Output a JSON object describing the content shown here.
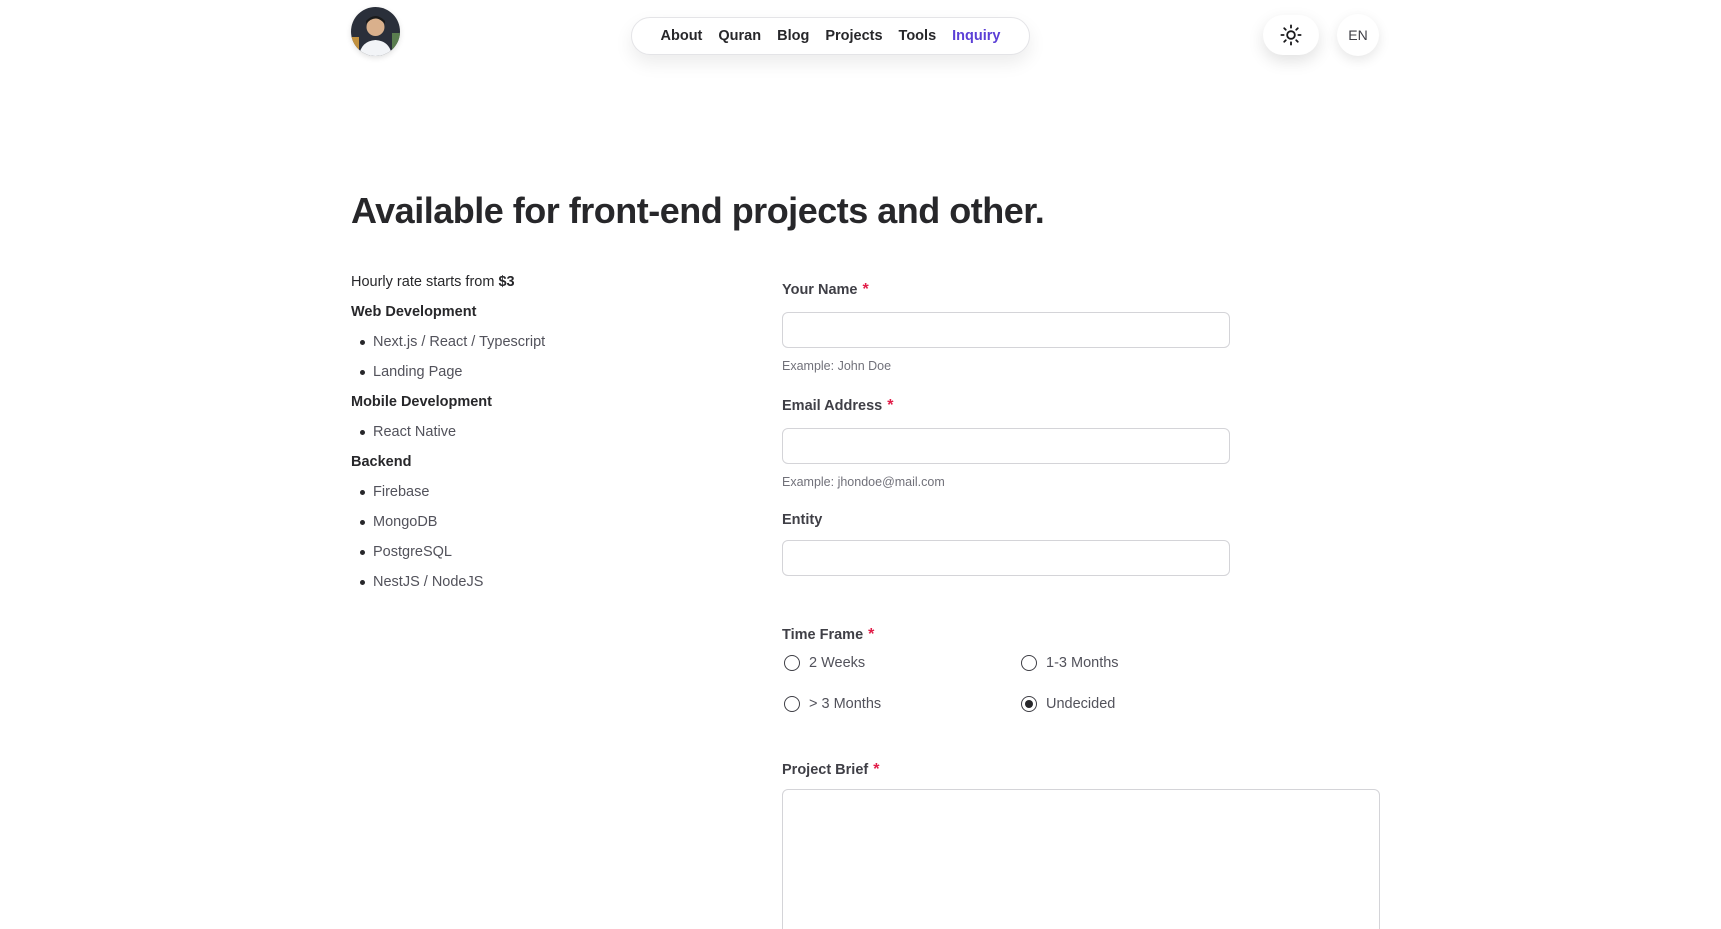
{
  "header": {
    "nav": [
      "About",
      "Quran",
      "Blog",
      "Projects",
      "Tools",
      "Inquiry"
    ],
    "active_nav": "Inquiry",
    "lang": "EN"
  },
  "title": "Available for front-end projects and other.",
  "services": {
    "rate_prefix": "Hourly rate starts from",
    "rate_value": "$3",
    "categories": [
      {
        "name": "Web Development",
        "items": [
          "Next.js / React / Typescript",
          "Landing Page"
        ]
      },
      {
        "name": "Mobile Development",
        "items": [
          "React Native"
        ]
      },
      {
        "name": "Backend",
        "items": [
          "Firebase",
          "MongoDB",
          "PostgreSQL",
          "NestJS / NodeJS"
        ]
      }
    ]
  },
  "form": {
    "name": {
      "label": "Your Name",
      "required_mark": "*",
      "value": "",
      "hint": "Example: John Doe"
    },
    "email": {
      "label": "Email Address",
      "required_mark": "*",
      "value": "",
      "hint": "Example: jhondoe@mail.com"
    },
    "entity": {
      "label": "Entity",
      "value": ""
    },
    "timeframe": {
      "label": "Time Frame",
      "required_mark": "*",
      "options": [
        "2 Weeks",
        "1-3 Months",
        "> 3 Months",
        "Undecided"
      ],
      "selected": "Undecided"
    },
    "brief": {
      "label": "Project Brief",
      "required_mark": "*",
      "value": ""
    }
  },
  "colors": {
    "accent": "#5b3fd6",
    "required": "#e11d48"
  }
}
